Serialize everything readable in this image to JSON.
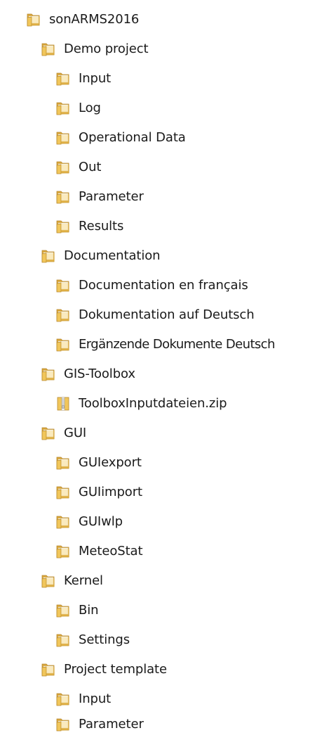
{
  "tree": {
    "root": {
      "label": "sonARMS2016",
      "icon": "folder-icon"
    },
    "demo_project": {
      "label": "Demo project",
      "icon": "folder-icon",
      "children": [
        {
          "label": "Input",
          "icon": "folder-icon"
        },
        {
          "label": "Log",
          "icon": "folder-icon"
        },
        {
          "label": "Operational Data",
          "icon": "folder-icon"
        },
        {
          "label": "Out",
          "icon": "folder-icon"
        },
        {
          "label": "Parameter",
          "icon": "folder-icon"
        },
        {
          "label": "Results",
          "icon": "folder-icon"
        }
      ]
    },
    "documentation": {
      "label": "Documentation",
      "icon": "folder-icon",
      "children": [
        {
          "label": "Documentation en français",
          "icon": "folder-icon"
        },
        {
          "label": "Dokumentation auf Deutsch",
          "icon": "folder-icon"
        },
        {
          "label": "Ergänzende Dokumente Deutsch",
          "icon": "folder-icon"
        }
      ]
    },
    "gis_toolbox": {
      "label": "GIS-Toolbox",
      "icon": "folder-icon",
      "children": [
        {
          "label": "ToolboxInputdateien.zip",
          "icon": "zip-file-icon"
        }
      ]
    },
    "gui": {
      "label": "GUI",
      "icon": "folder-icon",
      "children": [
        {
          "label": "GUIexport",
          "icon": "folder-icon"
        },
        {
          "label": "GUIimport",
          "icon": "folder-icon"
        },
        {
          "label": "GUIwlp",
          "icon": "folder-icon"
        },
        {
          "label": "MeteoStat",
          "icon": "folder-icon"
        }
      ]
    },
    "kernel": {
      "label": "Kernel",
      "icon": "folder-icon",
      "children": [
        {
          "label": "Bin",
          "icon": "folder-icon"
        },
        {
          "label": "Settings",
          "icon": "folder-icon"
        }
      ]
    },
    "project_template": {
      "label": "Project template",
      "icon": "folder-icon",
      "children": [
        {
          "label": "Input",
          "icon": "folder-icon"
        },
        {
          "label": "Parameter",
          "icon": "folder-icon"
        }
      ]
    }
  },
  "colors": {
    "folder_front": "#f1c65a",
    "folder_back": "#d9a63b",
    "folder_edge": "#b8892e",
    "text": "#1a1a1a"
  }
}
